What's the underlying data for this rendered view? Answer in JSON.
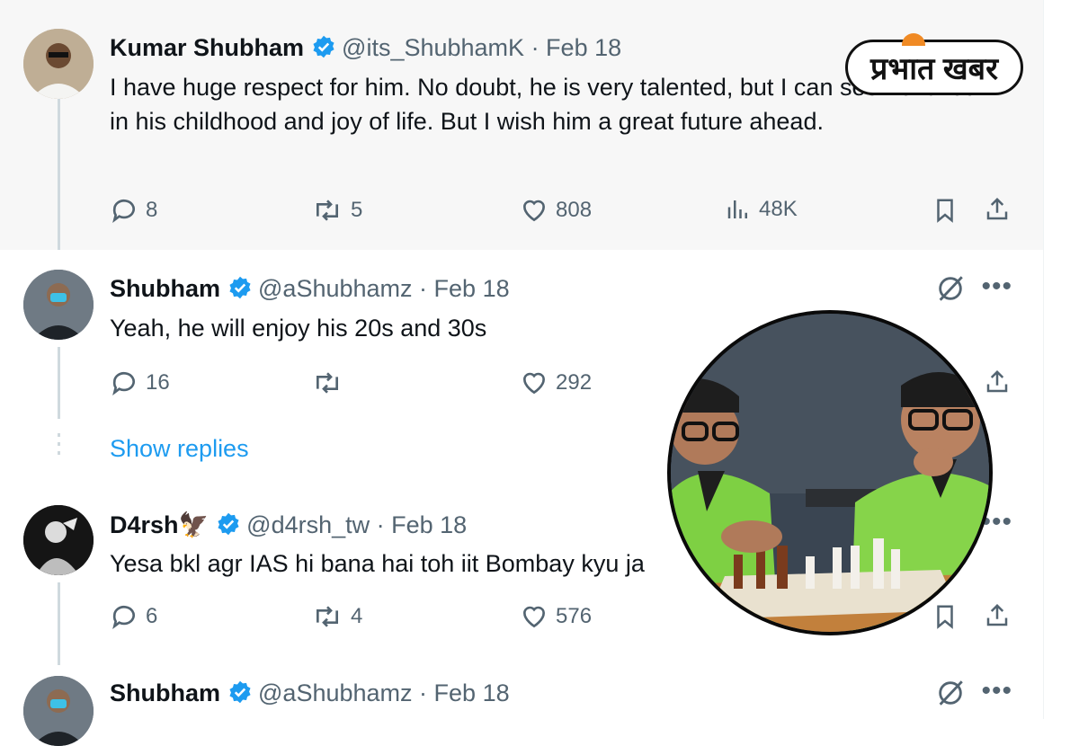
{
  "logo": {
    "text": "प्रभात खबर"
  },
  "tweets": [
    {
      "name": "Kumar Shubham",
      "handle": "@its_ShubhamK",
      "date": "· Feb 18",
      "text": "I have huge respect for him. No doubt, he is very talented, but I can see he failed in his childhood and joy of life. But I wish him a great future ahead.",
      "replies": "8",
      "retweets": "5",
      "likes": "808",
      "views": "48K"
    },
    {
      "name": "Shubham",
      "handle": "@aShubhamz",
      "date": "· Feb 18",
      "text": "Yeah, he will enjoy his 20s and 30s",
      "replies": "16",
      "retweets": "",
      "likes": "292",
      "show_replies": "Show replies"
    },
    {
      "name": "D4rsh🦅",
      "handle": "@d4rsh_tw",
      "date": "· Feb 18",
      "text": "Yesa bkl agr IAS hi bana hai toh iit Bombay kyu ja",
      "replies": "6",
      "retweets": "4",
      "likes": "576"
    },
    {
      "name": "Shubham",
      "handle": "@aShubhamz",
      "date": "· Feb 18"
    }
  ],
  "more_label": "•••",
  "colors": {
    "verified": "#1d9bf0",
    "link": "#1d9bf0",
    "muted": "#536471"
  }
}
